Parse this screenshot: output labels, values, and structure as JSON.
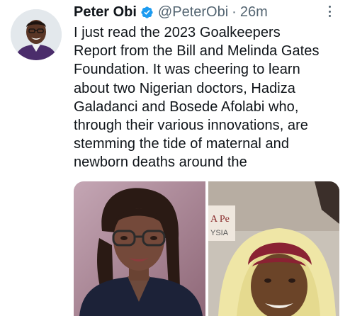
{
  "author": {
    "name": "Peter Obi",
    "handle": "@PeterObi",
    "separator": "·",
    "time": "26m",
    "verified": true
  },
  "tweet": {
    "lines": [
      "I just read the 2023 Goalkeepers",
      "Report from the Bill and Melinda Gates",
      "Foundation. It was cheering to learn",
      "about two Nigerian doctors, Hadiza",
      "Galadanci and Bosede Afolabi who,",
      "through their various innovations, are",
      "stemming the tide of maternal and",
      "newborn deaths around the"
    ]
  },
  "media": {
    "background_sign_text": [
      "A Pe",
      "YSIA"
    ]
  },
  "icons": {
    "verified": "verified-badge-icon",
    "more": "more-options-icon"
  },
  "colors": {
    "verified_blue": "#1d9bf0",
    "secondary_text": "#536471",
    "primary_text": "#0f1419"
  }
}
